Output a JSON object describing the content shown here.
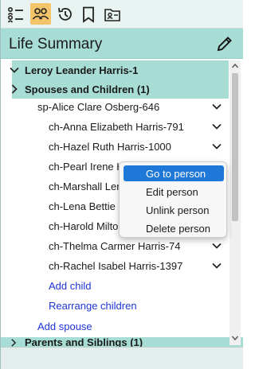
{
  "toolbar": {
    "icons": [
      "list-icon",
      "people-icon",
      "history-icon",
      "bookmark-icon",
      "contact-card-icon"
    ],
    "active_color": "#f3c46a"
  },
  "header": {
    "title": "Life Summary"
  },
  "tree": {
    "person": "Leroy Leander Harris-1",
    "spouses_section": "Spouses and Children (1)",
    "spouse": "sp-Alice Clare Osberg-646",
    "children": [
      "ch-Anna Elizabeth Harris-791",
      "ch-Hazel Ruth Harris-1000",
      "ch-Pearl Irene Ha",
      "ch-Marshall Lero",
      "ch-Lena Bettie H",
      "ch-Harold Milton",
      "ch-Thelma Carmer Harris-74",
      "ch-Rachel Isabel Harris-1397"
    ],
    "add_child": "Add child",
    "rearrange_children": "Rearrange children",
    "add_spouse": "Add spouse",
    "parents_section": "Parents and Siblings (1)"
  },
  "context_menu": {
    "items": [
      "Go to person",
      "Edit person",
      "Unlink person",
      "Delete person"
    ],
    "selected_index": 0
  },
  "colors": {
    "highlight": "#a7ddd4",
    "link": "#1f35d8",
    "menu_selection": "#1e78d7"
  }
}
